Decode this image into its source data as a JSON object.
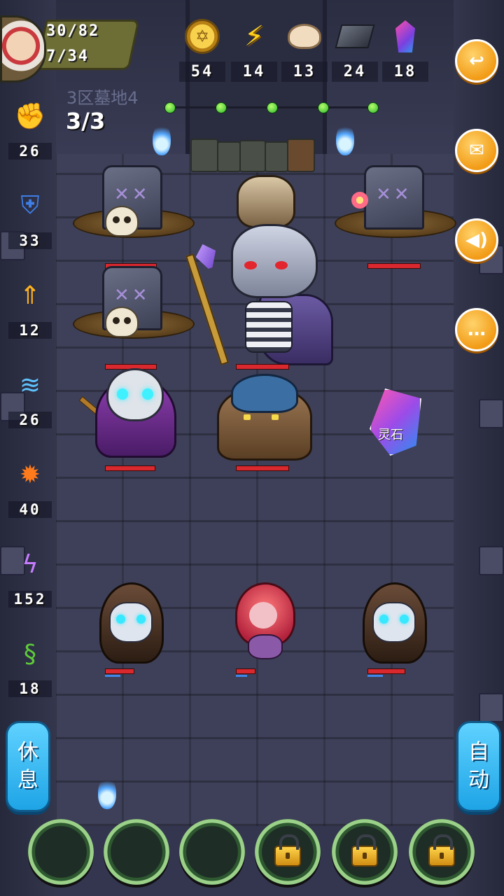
{
  "player": {
    "hp_text": "30/82",
    "sub_text": "7/34"
  },
  "resources": [
    {
      "icon": "gold-coin-icon",
      "value": "54"
    },
    {
      "icon": "lightning-energy-icon",
      "value": "14"
    },
    {
      "icon": "bun-food-icon",
      "value": "13"
    },
    {
      "icon": "iron-ingot-icon",
      "value": "24"
    },
    {
      "icon": "crystal-gem-icon",
      "value": "18"
    }
  ],
  "stage": {
    "label": "3区墓地4",
    "wave": "3/3",
    "progress_dots": 5
  },
  "stats": [
    {
      "icon": "fist-attack-icon",
      "value": "26"
    },
    {
      "icon": "shield-defense-icon",
      "value": "33"
    },
    {
      "icon": "fire-sword-icon",
      "value": "12"
    },
    {
      "icon": "water-wave-icon",
      "value": "26"
    },
    {
      "icon": "fireball-icon",
      "value": "40"
    },
    {
      "icon": "lightning-bolt-icon",
      "value": "152"
    },
    {
      "icon": "poison-snake-icon",
      "value": "18"
    }
  ],
  "side_buttons": {
    "rest": "休息",
    "auto": "自动"
  },
  "right_menu": [
    {
      "name": "return-button",
      "icon": "return-arrow-icon"
    },
    {
      "name": "mail-button",
      "icon": "envelope-icon"
    },
    {
      "name": "sound-button",
      "icon": "speaker-icon"
    },
    {
      "name": "chat-button",
      "icon": "chat-bubble-icon"
    }
  ],
  "drop": {
    "label": "灵石"
  },
  "skill_slots": [
    {
      "locked": false
    },
    {
      "locked": false
    },
    {
      "locked": false
    },
    {
      "locked": true
    },
    {
      "locked": true
    },
    {
      "locked": true
    }
  ],
  "colors": {
    "accent_orange": "#f29b16",
    "side_button_blue": "#1ea4e6",
    "hp_red": "#d9282e",
    "progress_green": "#2bb52b"
  }
}
